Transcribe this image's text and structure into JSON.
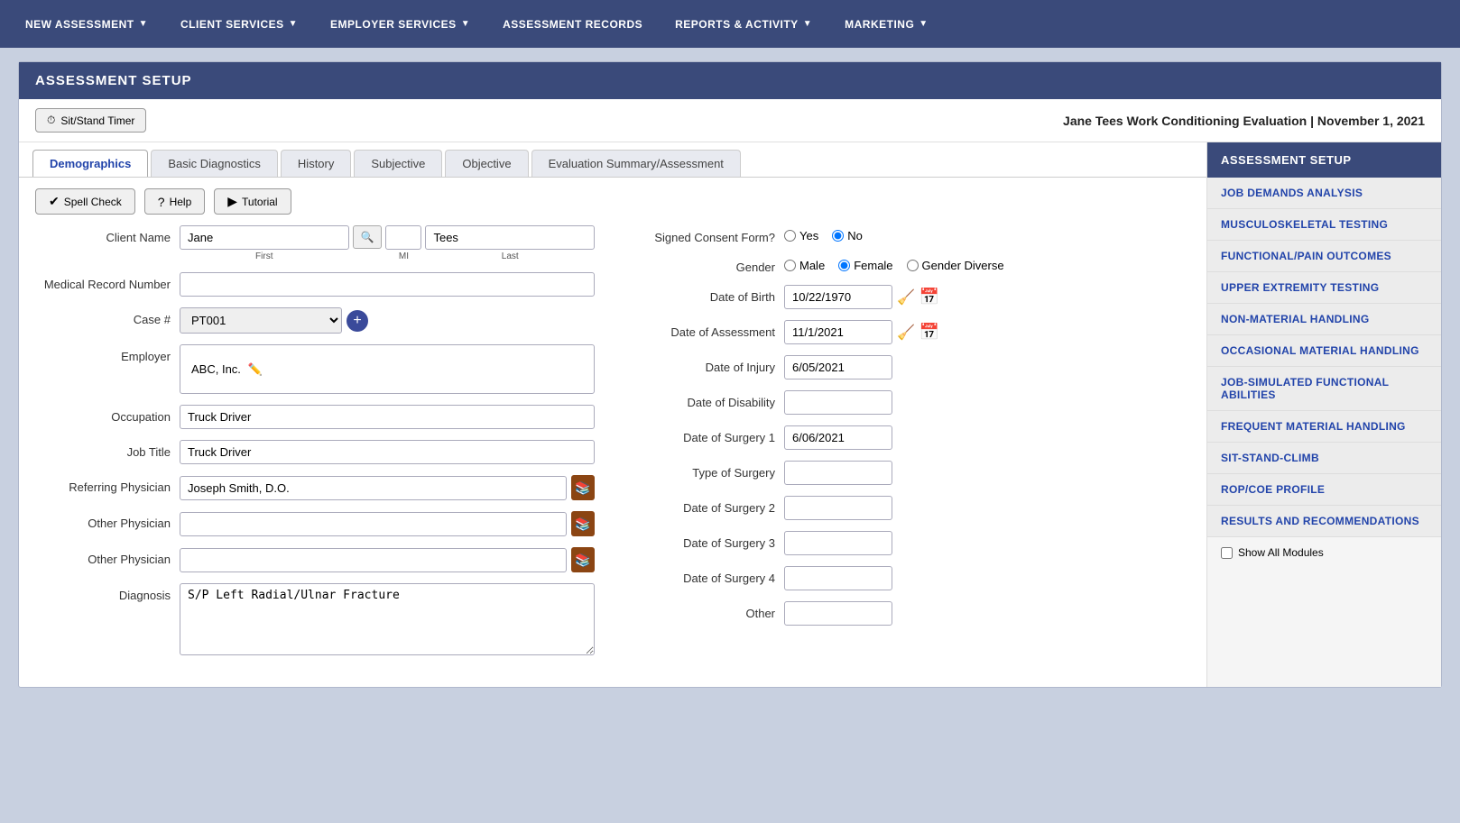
{
  "nav": {
    "items": [
      {
        "label": "NEW ASSESSMENT",
        "hasDropdown": true
      },
      {
        "label": "CLIENT SERVICES",
        "hasDropdown": true
      },
      {
        "label": "EMPLOYER SERVICES",
        "hasDropdown": true
      },
      {
        "label": "ASSESSMENT RECORDS",
        "hasDropdown": false
      },
      {
        "label": "REPORTS & ACTIVITY",
        "hasDropdown": true
      },
      {
        "label": "MARKETING",
        "hasDropdown": true
      }
    ]
  },
  "main": {
    "header": "ASSESSMENT SETUP",
    "sit_stand_label": "Sit/Stand Timer",
    "patient_title": "Jane Tees Work Conditioning Evaluation | November 1, 2021"
  },
  "tabs": [
    {
      "label": "Demographics",
      "active": true
    },
    {
      "label": "Basic Diagnostics",
      "active": false
    },
    {
      "label": "History",
      "active": false
    },
    {
      "label": "Subjective",
      "active": false
    },
    {
      "label": "Objective",
      "active": false
    },
    {
      "label": "Evaluation Summary/Assessment",
      "active": false
    }
  ],
  "action_buttons": [
    {
      "label": "Spell Check",
      "icon": "✔"
    },
    {
      "label": "Help",
      "icon": "?"
    },
    {
      "label": "Tutorial",
      "icon": "▶"
    }
  ],
  "form": {
    "client_name_label": "Client Name",
    "first_name": "Jane",
    "mi": "",
    "last_name": "Tees",
    "first_placeholder": "First",
    "mi_placeholder": "MI",
    "last_placeholder": "Last",
    "medical_record_label": "Medical Record Number",
    "medical_record_value": "",
    "case_label": "Case #",
    "case_value": "PT001",
    "employer_label": "Employer",
    "employer_value": "ABC, Inc.",
    "occupation_label": "Occupation",
    "occupation_value": "Truck Driver",
    "job_title_label": "Job Title",
    "job_title_value": "Truck Driver",
    "referring_physician_label": "Referring Physician",
    "referring_physician_value": "Joseph Smith, D.O.",
    "other_physician1_label": "Other Physician",
    "other_physician1_value": "",
    "other_physician2_label": "Other Physician",
    "other_physician2_value": "",
    "diagnosis_label": "Diagnosis",
    "diagnosis_value": "S/P Left Radial/Ulnar Fracture"
  },
  "right_form": {
    "consent_label": "Signed Consent Form?",
    "consent_yes": "Yes",
    "consent_no": "No",
    "consent_selected": "no",
    "gender_label": "Gender",
    "gender_male": "Male",
    "gender_female": "Female",
    "gender_diverse": "Gender Diverse",
    "gender_selected": "female",
    "dob_label": "Date of Birth",
    "dob_value": "10/22/1970",
    "date_assessment_label": "Date of Assessment",
    "date_assessment_value": "11/1/2021",
    "date_injury_label": "Date of Injury",
    "date_injury_value": "6/05/2021",
    "date_disability_label": "Date of Disability",
    "date_disability_value": "",
    "date_surgery1_label": "Date of Surgery 1",
    "date_surgery1_value": "6/06/2021",
    "type_surgery_label": "Type of Surgery",
    "type_surgery_value": "",
    "date_surgery2_label": "Date of Surgery 2",
    "date_surgery2_value": "",
    "date_surgery3_label": "Date of Surgery 3",
    "date_surgery3_value": "",
    "date_surgery4_label": "Date of Surgery 4",
    "date_surgery4_value": "",
    "other_label": "Other",
    "other_value": ""
  },
  "sidebar": {
    "header": "ASSESSMENT SETUP",
    "items": [
      "JOB DEMANDS ANALYSIS",
      "MUSCULOSKELETAL TESTING",
      "FUNCTIONAL/PAIN OUTCOMES",
      "UPPER EXTREMITY TESTING",
      "NON-MATERIAL HANDLING",
      "OCCASIONAL MATERIAL HANDLING",
      "JOB-SIMULATED FUNCTIONAL ABILITIES",
      "FREQUENT MATERIAL HANDLING",
      "SIT-STAND-CLIMB",
      "ROP/COE PROFILE",
      "RESULTS AND RECOMMENDATIONS"
    ],
    "show_all_label": "Show All Modules"
  }
}
